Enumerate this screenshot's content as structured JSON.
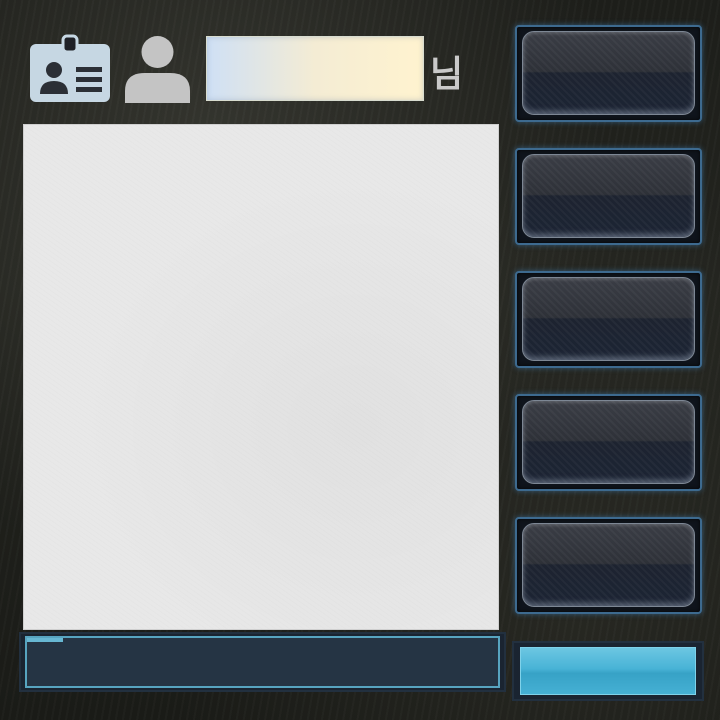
{
  "header": {
    "name_value": "",
    "honorific": "님"
  },
  "icons": {
    "id_card": "id-card-icon",
    "user": "user-icon"
  },
  "main": {
    "content": ""
  },
  "side_buttons": [
    {
      "label": ""
    },
    {
      "label": ""
    },
    {
      "label": ""
    },
    {
      "label": ""
    },
    {
      "label": ""
    }
  ],
  "footer": {
    "input_value": "",
    "button_label": ""
  },
  "colors": {
    "accent": "#4fb6d9",
    "panel": "#e8e8e8",
    "button_border": "#3d6a8f"
  }
}
